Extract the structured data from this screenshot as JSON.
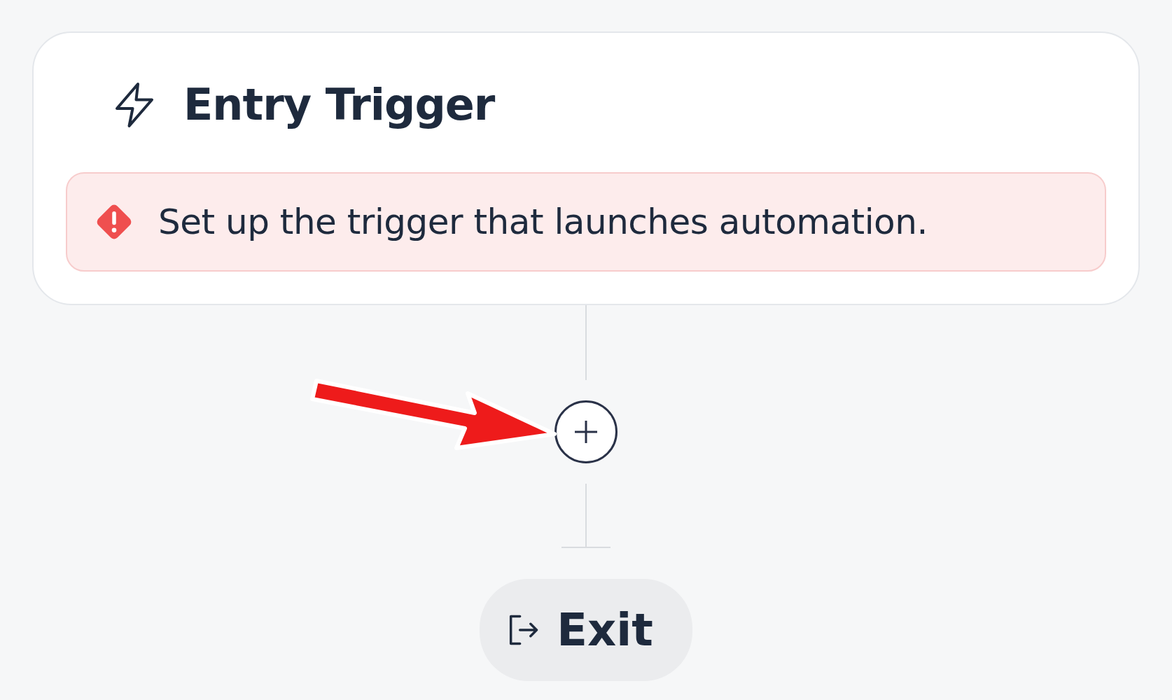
{
  "trigger": {
    "title": "Entry Trigger",
    "alert": "Set up the trigger that launches automation."
  },
  "exit": {
    "label": "Exit"
  }
}
